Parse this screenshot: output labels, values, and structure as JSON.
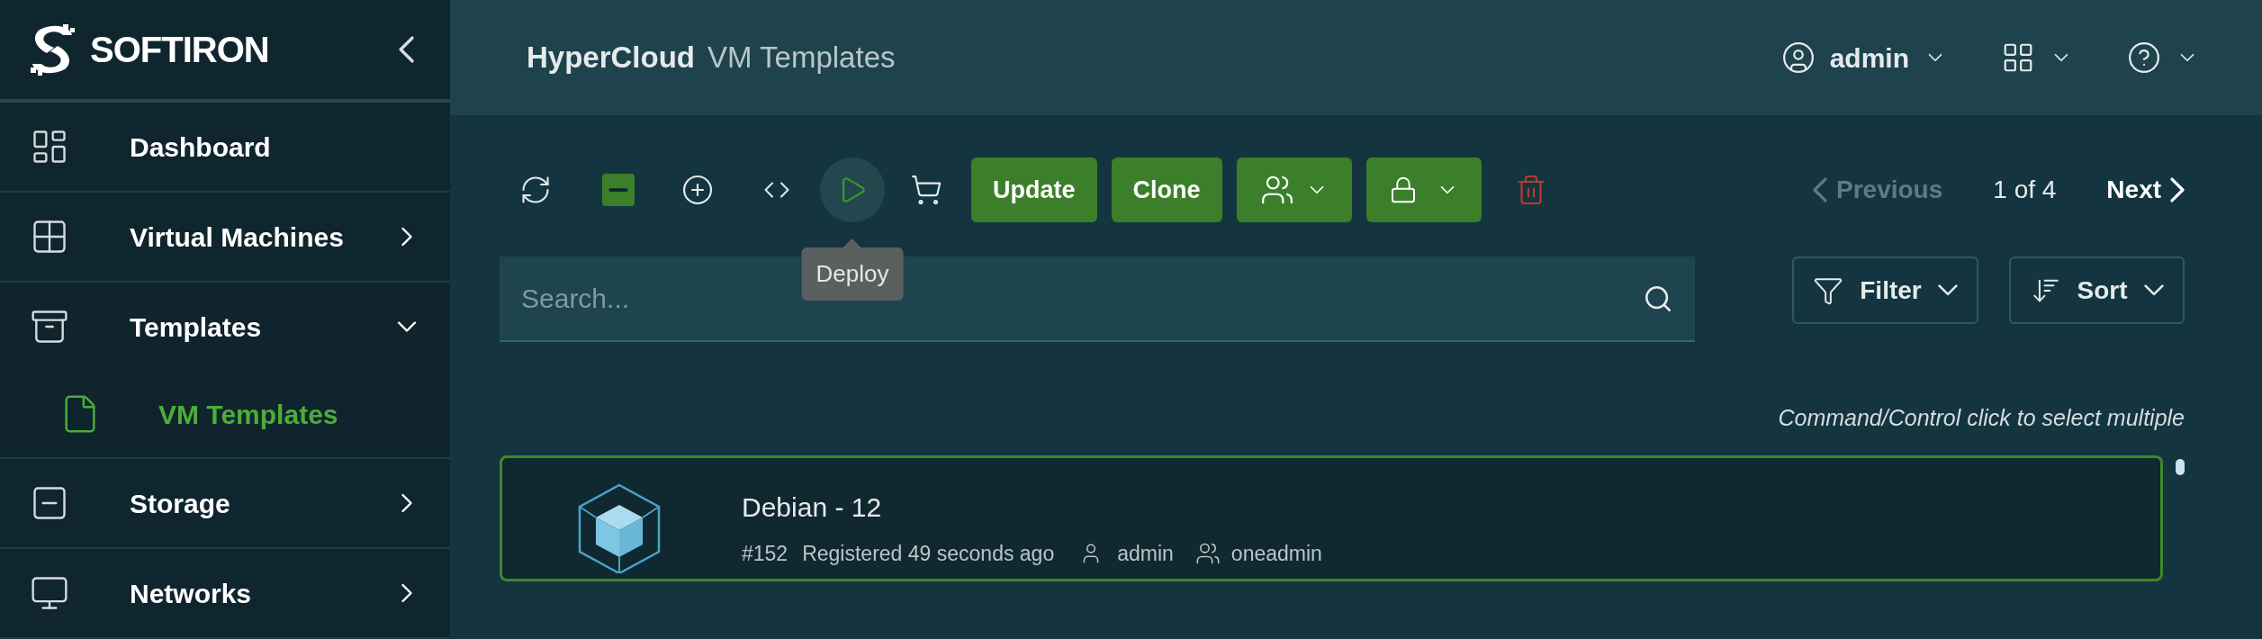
{
  "brand": {
    "name": "SOFTIRON"
  },
  "sidebar": {
    "items": [
      {
        "kind": "dashboard",
        "label": "Dashboard"
      },
      {
        "kind": "machines",
        "label": "Virtual Machines",
        "expanded": false
      },
      {
        "kind": "templates",
        "label": "Templates",
        "expanded": true,
        "children": [
          {
            "kind": "file",
            "label": "VM Templates",
            "selected": true
          }
        ]
      },
      {
        "kind": "storage",
        "label": "Storage",
        "expanded": false
      },
      {
        "kind": "networks",
        "label": "Networks",
        "expanded": false
      }
    ]
  },
  "header": {
    "product": "HyperCloud",
    "page": "VM Templates",
    "user": "admin"
  },
  "toolbar": {
    "actions": [
      {
        "kind": "refresh"
      },
      {
        "kind": "minus"
      },
      {
        "kind": "add"
      },
      {
        "kind": "code"
      },
      {
        "kind": "play",
        "tooltip": "Deploy"
      },
      {
        "kind": "cart"
      },
      {
        "kind": "text",
        "label": "Update"
      },
      {
        "kind": "text",
        "label": "Clone"
      },
      {
        "kind": "users"
      },
      {
        "kind": "lock"
      },
      {
        "kind": "delete"
      }
    ]
  },
  "pagination": {
    "previous": "Previous",
    "previous_disabled": true,
    "page": "1 of 4",
    "next": "Next"
  },
  "search": {
    "placeholder": "Search..."
  },
  "filter": {
    "label": "Filter"
  },
  "sort": {
    "label": "Sort"
  },
  "hint": "Command/Control click to select multiple",
  "templates": [
    {
      "name": "Debian - 12",
      "id": "#152",
      "registered": "Registered 49 seconds ago",
      "owner": "admin",
      "group": "oneadmin",
      "selected": true
    }
  ]
}
